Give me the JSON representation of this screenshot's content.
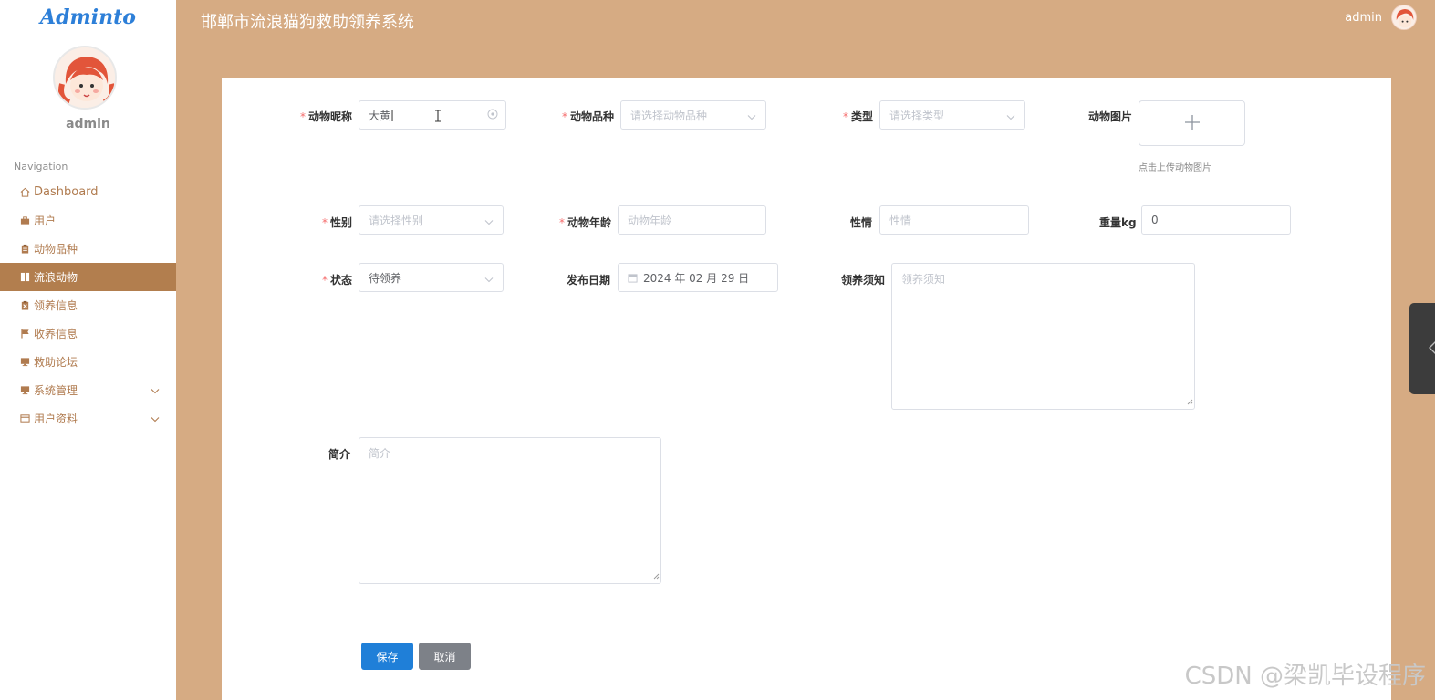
{
  "app": {
    "logo": "Adminto",
    "title": "邯郸市流浪猫狗救助领养系统",
    "username": "admin"
  },
  "sidebar": {
    "username": "admin",
    "nav_title": "Navigation",
    "items": [
      {
        "label": "Dashboard",
        "icon": "home-icon",
        "active": false
      },
      {
        "label": "用户",
        "icon": "briefcase-icon",
        "active": false
      },
      {
        "label": "动物品种",
        "icon": "clipboard-icon",
        "active": false
      },
      {
        "label": "流浪动物",
        "icon": "grid-icon",
        "active": true
      },
      {
        "label": "领养信息",
        "icon": "clipboard-x-icon",
        "active": false
      },
      {
        "label": "收养信息",
        "icon": "flag-icon",
        "active": false
      },
      {
        "label": "救助论坛",
        "icon": "monitor-icon",
        "active": false
      },
      {
        "label": "系统管理",
        "icon": "monitor-icon",
        "active": false,
        "expandable": true
      },
      {
        "label": "用户资料",
        "icon": "card-icon",
        "active": false,
        "expandable": true
      }
    ]
  },
  "form": {
    "name": {
      "label": "动物昵称",
      "value": "大黄",
      "required": true
    },
    "breed": {
      "label": "动物品种",
      "placeholder": "请选择动物品种",
      "required": true
    },
    "type": {
      "label": "类型",
      "placeholder": "请选择类型",
      "required": true
    },
    "image": {
      "label": "动物图片",
      "tip": "点击上传动物图片"
    },
    "gender": {
      "label": "性别",
      "placeholder": "请选择性别",
      "required": true
    },
    "age": {
      "label": "动物年龄",
      "placeholder": "动物年龄",
      "required": true
    },
    "temper": {
      "label": "性情",
      "placeholder": "性情"
    },
    "weight": {
      "label": "重量kg",
      "value": "0"
    },
    "status": {
      "label": "状态",
      "value": "待领养",
      "required": true
    },
    "date": {
      "label": "发布日期",
      "value": "2024 年 02 月 29 日"
    },
    "notice": {
      "label": "领养须知",
      "placeholder": "领养须知"
    },
    "intro": {
      "label": "简介",
      "placeholder": "简介"
    },
    "save_label": "保存",
    "cancel_label": "取消"
  },
  "watermark": "CSDN @梁凯毕设程序",
  "colors": {
    "background": "#d6ab83",
    "active_nav": "#b27e4e",
    "primary": "#1f7fd8",
    "required": "#f56c6c"
  }
}
